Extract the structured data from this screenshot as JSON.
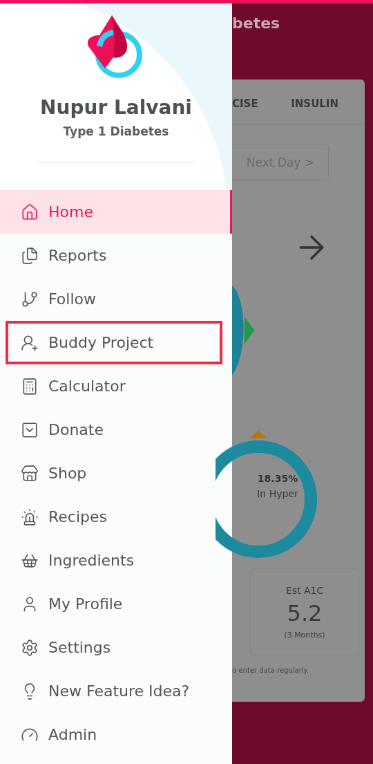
{
  "profile": {
    "name": "Nupur Lalvani",
    "subtitle": "Type 1 Diabetes"
  },
  "menu": [
    {
      "label": "Home",
      "selected": true,
      "highlighted": false
    },
    {
      "label": "Reports",
      "selected": false,
      "highlighted": false
    },
    {
      "label": "Follow",
      "selected": false,
      "highlighted": false
    },
    {
      "label": "Buddy Project",
      "selected": false,
      "highlighted": true
    },
    {
      "label": "Calculator",
      "selected": false,
      "highlighted": false
    },
    {
      "label": "Donate",
      "selected": false,
      "highlighted": false
    },
    {
      "label": "Shop",
      "selected": false,
      "highlighted": false
    },
    {
      "label": "Recipes",
      "selected": false,
      "highlighted": false
    },
    {
      "label": "Ingredients",
      "selected": false,
      "highlighted": false
    },
    {
      "label": "My Profile",
      "selected": false,
      "highlighted": false
    },
    {
      "label": "Settings",
      "selected": false,
      "highlighted": false
    },
    {
      "label": "New Feature Idea?",
      "selected": false,
      "highlighted": false
    },
    {
      "label": "Admin",
      "selected": false,
      "highlighted": false
    }
  ],
  "background": {
    "title": "betes",
    "tabs": [
      "CISE",
      "INSULIN"
    ],
    "next_button": "Next Day >",
    "donut": {
      "value": "18.35%",
      "label": "In Hyper"
    },
    "stat": {
      "label": "Est A1C",
      "value": "5.2",
      "period": "(3 Months)"
    },
    "note": "u enter data regularly."
  }
}
